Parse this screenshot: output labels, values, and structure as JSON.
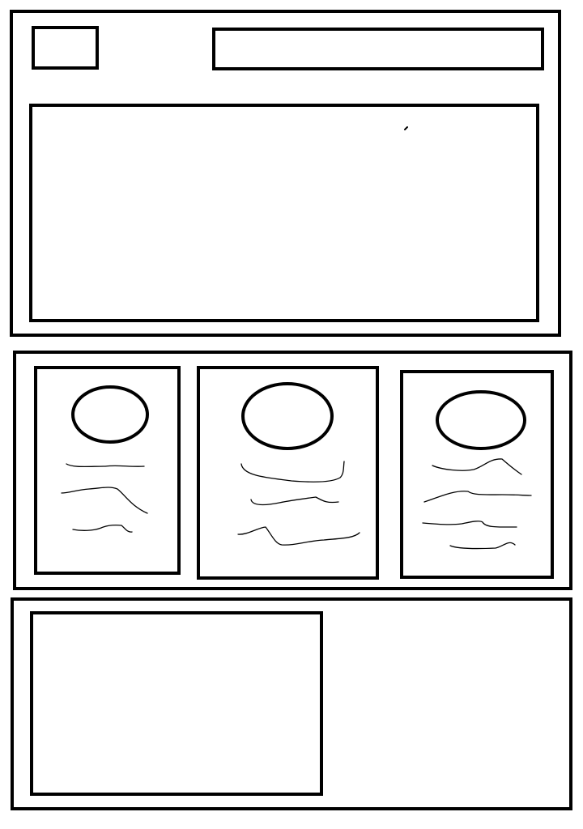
{
  "wireframe": {
    "line_color": "#000000",
    "background": "#ffffff",
    "header_section": {
      "logo_box": "logo-placeholder",
      "nav_box": "nav-bar-placeholder",
      "hero_box": "hero-image-placeholder"
    },
    "cards_section": {
      "card_count": 3,
      "cards": [
        {
          "avatar": "circle-placeholder",
          "text_lines": 3
        },
        {
          "avatar": "circle-placeholder",
          "text_lines": 3
        },
        {
          "avatar": "circle-placeholder",
          "text_lines": 4
        }
      ]
    },
    "footer_section": {
      "content_box": "footer-block-placeholder"
    }
  }
}
